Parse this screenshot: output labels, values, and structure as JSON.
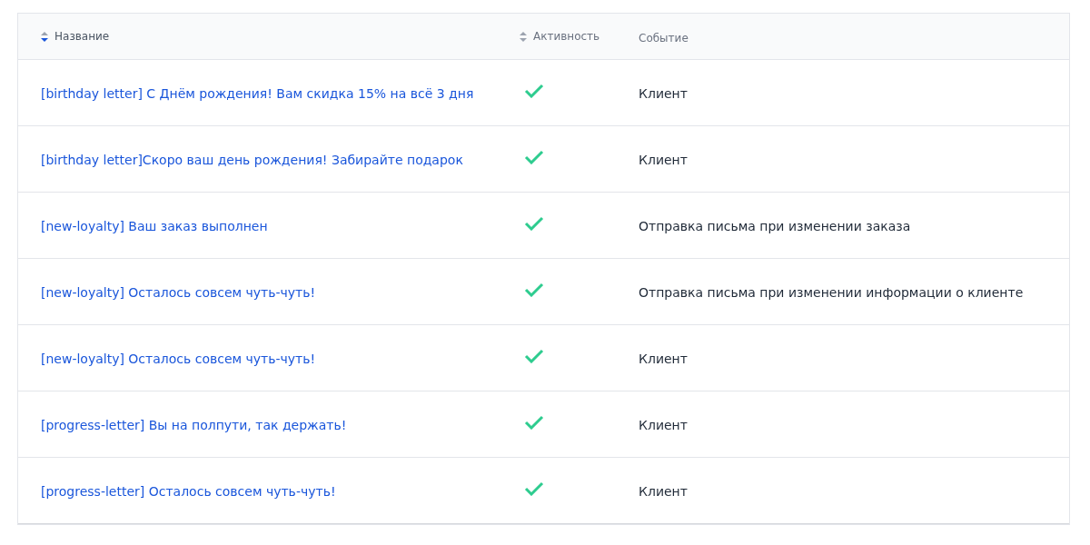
{
  "table": {
    "columns": [
      {
        "label": "Название",
        "sortable": true,
        "sorted_descending": true
      },
      {
        "label": "Активность",
        "sortable": true,
        "sorted_descending": false
      },
      {
        "label": "Событие",
        "sortable": false,
        "sorted_descending": false
      }
    ],
    "rows": [
      {
        "name": "[birthday letter] С Днём рождения! Вам скидка 15% на всё 3 дня",
        "active": true,
        "event": "Клиент"
      },
      {
        "name": "[birthday letter]Скоро ваш день рождения! Забирайте подарок",
        "active": true,
        "event": "Клиент"
      },
      {
        "name": "[new-loyalty] Ваш заказ выполнен",
        "active": true,
        "event": "Отправка письма при изменении заказа"
      },
      {
        "name": "[new-loyalty] Осталось совсем чуть-чуть!",
        "active": true,
        "event": "Отправка письма при изменении информации о клиенте"
      },
      {
        "name": "[new-loyalty] Осталось совсем чуть-чуть!",
        "active": true,
        "event": "Клиент"
      },
      {
        "name": "[progress-letter] Вы на полпути, так держать!",
        "active": true,
        "event": "Клиент"
      },
      {
        "name": "[progress-letter] Осталось совсем чуть-чуть!",
        "active": true,
        "event": "Клиент"
      }
    ]
  }
}
